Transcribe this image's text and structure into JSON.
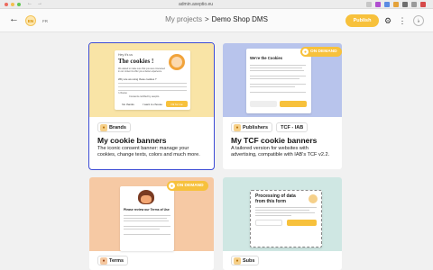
{
  "browser": {
    "url": "admin.axeptio.eu",
    "dot_colors": [
      "#ec6a5e",
      "#f4bf4f",
      "#61c554"
    ],
    "extension_colors": [
      "#c7c7c7",
      "#b04fd0",
      "#5b8be3",
      "#e4a23a",
      "#6e6e6e",
      "#9a9a9a",
      "#d64a4a"
    ]
  },
  "header": {
    "back_icon": "arrow-left-icon",
    "lang_en": "EN",
    "lang_fr": "FR",
    "breadcrumb_parent": "My projects",
    "breadcrumb_separator": ">",
    "breadcrumb_current": "Demo Shop DMS",
    "publish_label": "Publish",
    "accent_color": "#f7c13c"
  },
  "cards": [
    {
      "badges": [
        {
          "label": "Brands",
          "icon": "cookie-icon"
        }
      ],
      "title": "My cookie banners",
      "description": "The iconic consent banner: manage your cookies, change texts, colors and much more.",
      "preview_color": "#f9e4a6",
      "selected": true,
      "mock": {
        "greeting": "Hey it's us",
        "heading": "The cookies !",
        "body": "We waited to make sure that you were interested in our content to offer you a better experience",
        "question": "Why are we using these cookies ?",
        "link": "I choose",
        "footer": "Consents certified by axeptio",
        "btn_no": "No thanks",
        "btn_choose": "I want to choose",
        "btn_ok": "Ok for me"
      }
    },
    {
      "badges": [
        {
          "label": "Publishers",
          "icon": "publisher-icon"
        },
        {
          "label": "TCF - IAB"
        }
      ],
      "title": "My TCF cookie banners",
      "description": "A tailored version for websites with advertising, compatible with IAB's TCF v2.2.",
      "preview_color": "#b8c4ec",
      "on_demand": "ON DEMAND",
      "mock": {
        "heading": "We're the Cookies"
      }
    },
    {
      "badges": [
        {
          "label": "Terms",
          "icon": "terms-icon"
        }
      ],
      "preview_color": "#f6c9a4",
      "on_demand": "ON DEMAND",
      "mock": {
        "heading": "Please review our Terms of Use"
      }
    },
    {
      "badges": [
        {
          "label": "Subs",
          "icon": "subs-icon"
        }
      ],
      "preview_color": "#cfe7e3",
      "mock": {
        "heading": "Processing of data from this form"
      }
    }
  ]
}
